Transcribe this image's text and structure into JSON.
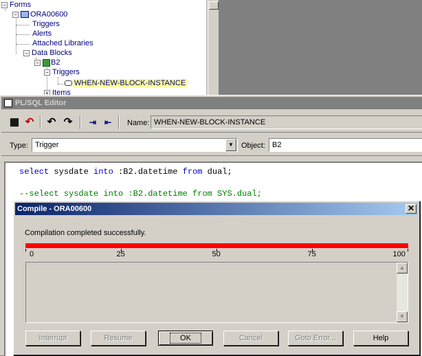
{
  "navigator": {
    "items": [
      {
        "label": "Forms"
      },
      {
        "label": "ORA00600"
      },
      {
        "label": "Triggers"
      },
      {
        "label": "Alerts"
      },
      {
        "label": "Attached Libraries"
      },
      {
        "label": "Data Blocks"
      },
      {
        "label": "B2"
      },
      {
        "label": "Triggers"
      },
      {
        "label": "WHEN-NEW-BLOCK-INSTANCE"
      },
      {
        "label": "Items"
      }
    ]
  },
  "editor": {
    "title": "PL/SQL Editor",
    "name_label": "Name:",
    "name_value": "WHEN-NEW-BLOCK-INSTANCE",
    "type_label": "Type:",
    "type_value": "Trigger",
    "object_label": "Object:",
    "object_value": "B2",
    "code": {
      "line1": [
        "select",
        " sysdate ",
        "into",
        " :B2.datetime ",
        "from",
        " dual;"
      ],
      "line2": "--select sysdate into :B2.datetime from SYS.dual;"
    }
  },
  "dialog": {
    "title": "Compile - ORA00600",
    "message": "Compilation completed successfully.",
    "progress_percent": 100,
    "ticks": [
      "0",
      "25",
      "50",
      "75",
      "100"
    ],
    "buttons": {
      "interrupt": "Interrupt",
      "resume": "Resume",
      "ok": "OK",
      "cancel": "Cancel",
      "goto_error": "Goto Error...",
      "help": "Help"
    }
  },
  "colors": {
    "progress": "#ff0000",
    "keyword": "#0000c0",
    "comment": "#008000",
    "selection": "#ffff99"
  }
}
